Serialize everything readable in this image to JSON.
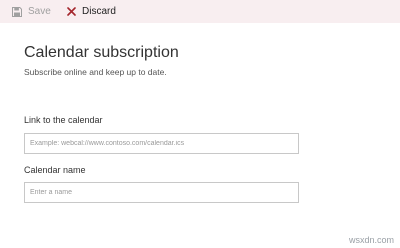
{
  "toolbar": {
    "save_label": "Save",
    "discard_label": "Discard",
    "save_icon": "save-icon",
    "discard_icon": "close-icon",
    "background": "#f8eef0"
  },
  "page": {
    "title": "Calendar subscription",
    "subtitle": "Subscribe online and keep up to date."
  },
  "form": {
    "link": {
      "label": "Link to the calendar",
      "placeholder": "Example: webcal://www.contoso.com/calendar.ics",
      "value": ""
    },
    "name": {
      "label": "Calendar name",
      "placeholder": "Enter a name",
      "value": ""
    }
  },
  "watermark": "wsxdn.com"
}
